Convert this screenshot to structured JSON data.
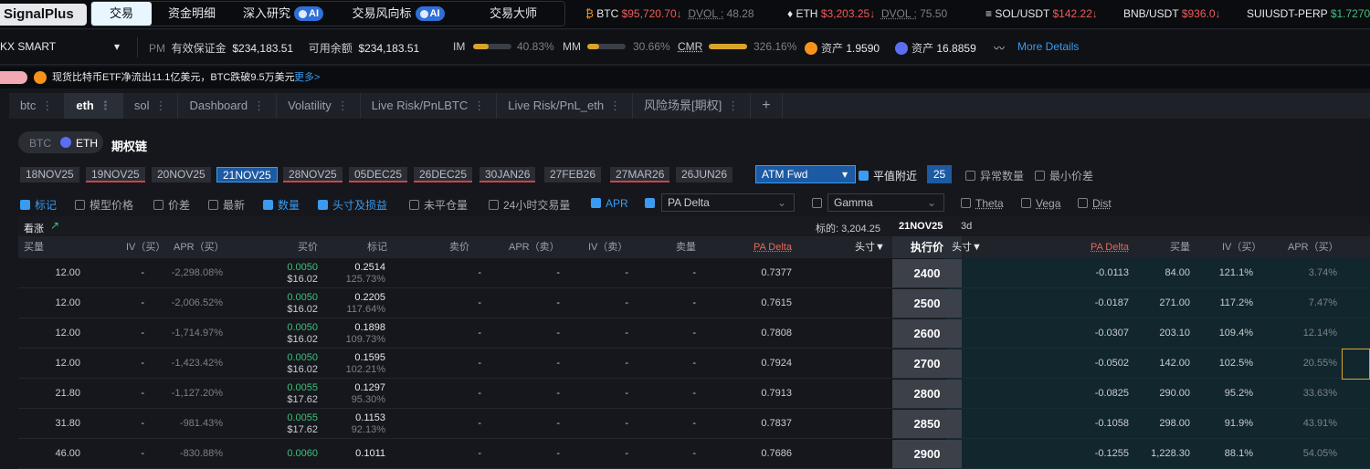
{
  "brand": "SignalPlus",
  "nav": [
    {
      "label": "交易",
      "active": true
    },
    {
      "label": "资金明细"
    },
    {
      "label": "深入研究",
      "ai": "AI"
    },
    {
      "label": "交易风向标",
      "ai": "AI"
    },
    {
      "label": "交易大师"
    }
  ],
  "tickers": [
    {
      "sym": "BTC",
      "price": "$95,720.70",
      "arrow": "↓",
      "dvol_label": "DVOL :",
      "dvol": "48.28"
    },
    {
      "sym": "ETH",
      "price": "$3,203.25",
      "arrow": "↓",
      "dvol_label": "DVOL :",
      "dvol": "75.50"
    },
    {
      "sym": "SOL/USDT",
      "price": "$142.22",
      "arrow": "↓"
    },
    {
      "sym": "BNB/USDT",
      "price": "$936.0",
      "arrow": "↓"
    },
    {
      "sym": "SUIUSDT-PERP",
      "price": "$1.7270"
    }
  ],
  "account": {
    "name": "KX SMART",
    "pm": "PM",
    "margin_label": "有效保证金",
    "margin": "$234,183.51",
    "avail_label": "可用余额",
    "avail": "$234,183.51",
    "im_label": "IM",
    "im": "40.83%",
    "im_fill": 0.4083,
    "mm_label": "MM",
    "mm": "30.66%",
    "mm_fill": 0.3066,
    "cmr_label": "CMR",
    "cmr": "326.16%",
    "cmr_fill": 1.0,
    "asset1_label": "资产",
    "asset1": "1.9590",
    "asset2_label": "资产",
    "asset2": "16.8859",
    "more": "More Details"
  },
  "news": {
    "text": "现货比特币ETF净流出11.1亿美元，BTC跌破9.5万美元",
    "more": "更多>"
  },
  "tabs": [
    "btc",
    "eth",
    "sol",
    "Dashboard",
    "Volatility",
    "Live Risk/PnLBTC",
    "Live Risk/PnL_eth",
    "风险场景[期权]",
    "+"
  ],
  "chain": {
    "coin_btc": "BTC",
    "coin_eth": "ETH",
    "title": "期权链"
  },
  "expiries": [
    "18NOV25",
    "19NOV25",
    "20NOV25",
    "21NOV25",
    "28NOV25",
    "05DEC25",
    "26DEC25",
    "30JAN26",
    "27FEB26",
    "27MAR26",
    "26JUN26"
  ],
  "atm": {
    "select": "ATM Fwd",
    "near_label": "平值附近",
    "near_value": "25",
    "abn_label": "异常数量",
    "min_label": "最小价差"
  },
  "cols": [
    {
      "label": "标记",
      "on": true
    },
    {
      "label": "模型价格"
    },
    {
      "label": "价差"
    },
    {
      "label": "最新"
    },
    {
      "label": "数量",
      "on": true
    },
    {
      "label": "头寸及损益",
      "on": true
    },
    {
      "label": "未平仓量"
    },
    {
      "label": "24小时交易量"
    },
    {
      "label": "APR",
      "on": true
    }
  ],
  "greek1": "PA Delta",
  "greek2": "Gamma",
  "greek_cbs": [
    "Theta",
    "Vega",
    "Dist"
  ],
  "summary": {
    "side": "看涨",
    "underlying_label": "标的:",
    "underlying": "3,204.25",
    "expiry": "21NOV25",
    "dte": "3d"
  },
  "headers": {
    "bid_qty": "买量",
    "iv_bid": "IV（买）",
    "apr_bid": "APR（买）",
    "bid": "买价",
    "mark": "标记",
    "ask": "卖价",
    "apr_ask": "APR（卖）",
    "iv_ask": "IV（卖）",
    "ask_qty": "卖量",
    "pa_delta": "PA Delta",
    "pos": "头寸▼",
    "strike": "执行价",
    "pos2": "头寸▼",
    "pa_delta2": "PA Delta",
    "bid_qty2": "买量",
    "iv_bid2": "IV（买）",
    "apr_bid2": "APR（买）"
  },
  "rows": [
    {
      "bq": "12.00",
      "iv": "-",
      "apr": "-2,298.08%",
      "bid": "0.0050",
      "bidusd": "$16.02",
      "mark": "0.2514",
      "markpct": "125.73%",
      "ask": "-",
      "apra": "-",
      "iva": "-",
      "aq": "-",
      "delta": "0.7377",
      "strike": "2400",
      "pdelta": "-0.0113",
      "pbq": "84.00",
      "piv": "121.1%",
      "papr": "3.74%"
    },
    {
      "bq": "12.00",
      "iv": "-",
      "apr": "-2,006.52%",
      "bid": "0.0050",
      "bidusd": "$16.02",
      "mark": "0.2205",
      "markpct": "117.64%",
      "ask": "-",
      "apra": "-",
      "iva": "-",
      "aq": "-",
      "delta": "0.7615",
      "strike": "2500",
      "pdelta": "-0.0187",
      "pbq": "271.00",
      "piv": "117.2%",
      "papr": "7.47%"
    },
    {
      "bq": "12.00",
      "iv": "-",
      "apr": "-1,714.97%",
      "bid": "0.0050",
      "bidusd": "$16.02",
      "mark": "0.1898",
      "markpct": "109.73%",
      "ask": "-",
      "apra": "-",
      "iva": "-",
      "aq": "-",
      "delta": "0.7808",
      "strike": "2600",
      "pdelta": "-0.0307",
      "pbq": "203.10",
      "piv": "109.4%",
      "papr": "12.14%"
    },
    {
      "bq": "12.00",
      "iv": "-",
      "apr": "-1,423.42%",
      "bid": "0.0050",
      "bidusd": "$16.02",
      "mark": "0.1595",
      "markpct": "102.21%",
      "ask": "-",
      "apra": "-",
      "iva": "-",
      "aq": "-",
      "delta": "0.7924",
      "strike": "2700",
      "pdelta": "-0.0502",
      "pbq": "142.00",
      "piv": "102.5%",
      "papr": "20.55%"
    },
    {
      "bq": "21.80",
      "iv": "-",
      "apr": "-1,127.20%",
      "bid": "0.0055",
      "bidusd": "$17.62",
      "mark": "0.1297",
      "markpct": "95.30%",
      "ask": "-",
      "apra": "-",
      "iva": "-",
      "aq": "-",
      "delta": "0.7913",
      "strike": "2800",
      "pdelta": "-0.0825",
      "pbq": "290.00",
      "piv": "95.2%",
      "papr": "33.63%"
    },
    {
      "bq": "31.80",
      "iv": "-",
      "apr": "-981.43%",
      "bid": "0.0055",
      "bidusd": "$17.62",
      "mark": "0.1153",
      "markpct": "92.13%",
      "ask": "-",
      "apra": "-",
      "iva": "-",
      "aq": "-",
      "delta": "0.7837",
      "strike": "2850",
      "pdelta": "-0.1058",
      "pbq": "298.00",
      "piv": "91.9%",
      "papr": "43.91%"
    },
    {
      "bq": "46.00",
      "iv": "-",
      "apr": "-830.88%",
      "bid": "0.0060",
      "bidusd": "",
      "mark": "0.1011",
      "markpct": "",
      "ask": "-",
      "apra": "-",
      "iva": "-",
      "aq": "-",
      "delta": "0.7686",
      "strike": "2900",
      "pdelta": "-0.1255",
      "pbq": "1,228.30",
      "piv": "88.1%",
      "papr": "54.05%"
    }
  ]
}
